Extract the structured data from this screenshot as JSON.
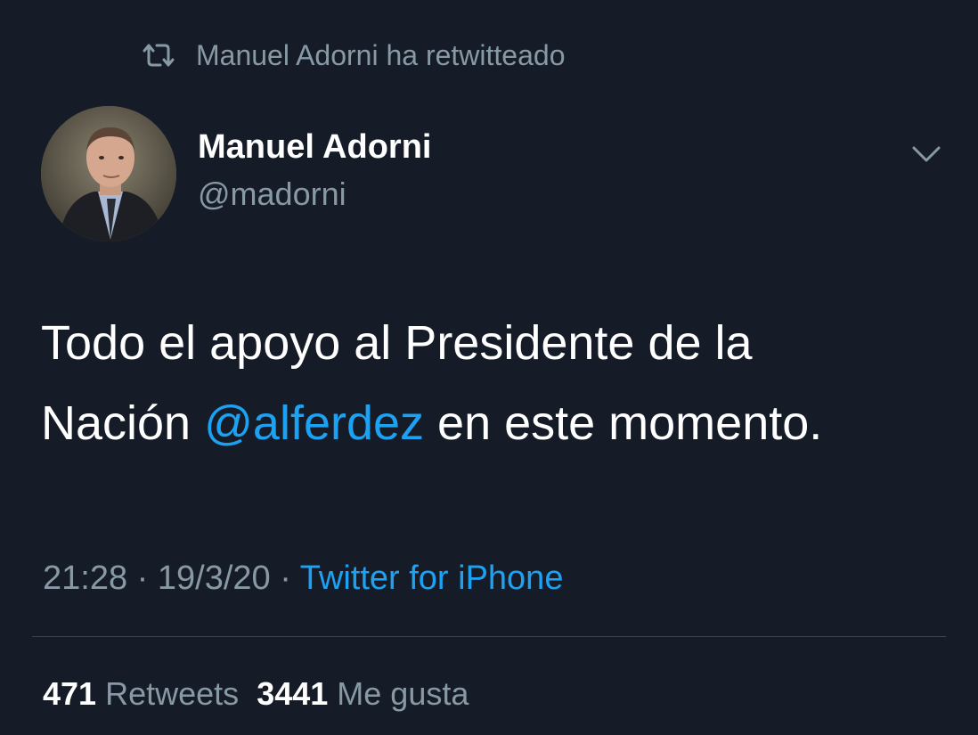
{
  "retweet_context": {
    "text": "Manuel Adorni ha retwitteado",
    "icon": "retweet-icon"
  },
  "author": {
    "name": "Manuel Adorni",
    "handle": "@madorni",
    "avatar": "profile-photo"
  },
  "tweet": {
    "text_line1": "Todo el apoyo al Presidente de la",
    "text_before_mention": "Nación ",
    "mention": "@alferdez",
    "text_after_mention": " en este momento."
  },
  "meta": {
    "time": "21:28",
    "separator1": " · ",
    "date": "19/3/20",
    "separator2": " · ",
    "source": "Twitter for iPhone"
  },
  "stats": {
    "retweets_count": "471",
    "retweets_label": "Retweets",
    "likes_count": "3441",
    "likes_label": "Me gusta"
  },
  "colors": {
    "background": "#161c27",
    "link": "#1da1f2",
    "secondary_text": "#8899a6",
    "primary_text": "#ffffff",
    "divider": "#38444d"
  }
}
